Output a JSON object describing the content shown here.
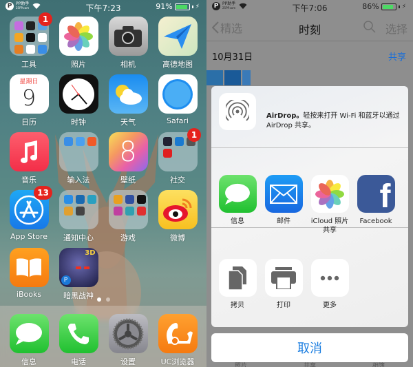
{
  "left_screen": {
    "status_bar": {
      "carrier_logo": "PP助手",
      "carrier_sub": "25PP.com",
      "wifi_icon": "wifi-icon",
      "time": "下午7:23",
      "battery_percent": "91%",
      "battery_level": 0.91,
      "charging_icon": "bolt-icon"
    },
    "apps": [
      {
        "label": "工具",
        "type": "folder",
        "badge": "1"
      },
      {
        "label": "照片",
        "type": "app"
      },
      {
        "label": "相机",
        "type": "app"
      },
      {
        "label": "高德地图",
        "type": "app"
      },
      {
        "label": "日历",
        "type": "app",
        "weekday": "星期日",
        "day": "9"
      },
      {
        "label": "时钟",
        "type": "app"
      },
      {
        "label": "天气",
        "type": "app"
      },
      {
        "label": "Safari",
        "type": "app"
      },
      {
        "label": "音乐",
        "type": "app"
      },
      {
        "label": "输入法",
        "type": "folder"
      },
      {
        "label": "壁纸",
        "type": "app",
        "glyph": "8"
      },
      {
        "label": "社交",
        "type": "folder",
        "badge": "1"
      },
      {
        "label": "App Store",
        "type": "app",
        "badge": "13"
      },
      {
        "label": "通知中心",
        "type": "folder"
      },
      {
        "label": "游戏",
        "type": "folder"
      },
      {
        "label": "微博",
        "type": "app"
      },
      {
        "label": "iBooks",
        "type": "app"
      },
      {
        "label": "暗黑战神",
        "type": "app",
        "tag": "3D"
      }
    ],
    "page_dots": {
      "count": 2,
      "active": 1
    },
    "dock": [
      {
        "label": "信息"
      },
      {
        "label": "电话"
      },
      {
        "label": "设置"
      },
      {
        "label": "UC浏览器"
      }
    ]
  },
  "right_screen": {
    "status_bar": {
      "carrier_logo": "PP助手",
      "carrier_sub": "25PP.com",
      "time": "下午7:06",
      "battery_percent": "86%",
      "battery_level": 0.86
    },
    "nav": {
      "back_label": "精选",
      "title": "时刻",
      "select_label": "选择"
    },
    "section": {
      "date": "10月31日",
      "share_label": "共享"
    },
    "share_sheet": {
      "airdrop_title": "AirDrop。",
      "airdrop_text": "轻按来打开 Wi-Fi 和蓝牙以通过 AirDrop 共享。",
      "share_targets": [
        {
          "label": "信息"
        },
        {
          "label": "邮件"
        },
        {
          "label": "iCloud 照片共享"
        },
        {
          "label": "Facebook"
        }
      ],
      "actions": [
        {
          "label": "拷贝"
        },
        {
          "label": "打印"
        },
        {
          "label": "更多"
        }
      ],
      "cancel_label": "取消"
    },
    "tab_bar_hint": [
      "照片",
      "共享",
      "相簿"
    ],
    "colors": {
      "link_blue": "#1a7de0",
      "badge_red": "#e5231d",
      "battery_green": "#4cd964"
    }
  }
}
